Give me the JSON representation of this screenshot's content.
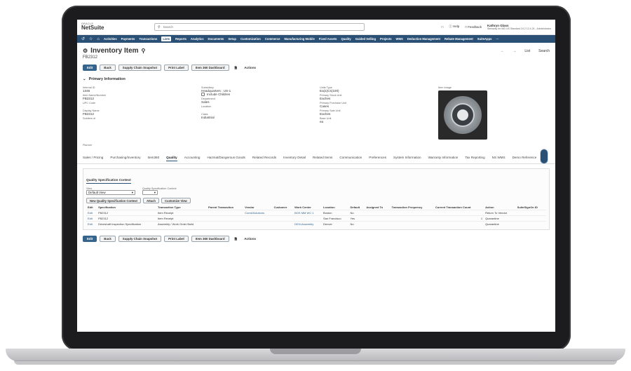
{
  "header": {
    "logo_top": "ORACLE",
    "logo_main": "NetSuite",
    "search_placeholder": "Search",
    "help": "Help",
    "feedback": "Feedback",
    "user_name": "Kathryn Glass",
    "user_role": "Steinway for WD US Standard 24.2 12.4.24 - Administrator"
  },
  "nav": {
    "items": [
      "Activities",
      "Payments",
      "Transactions",
      "Lists",
      "Reports",
      "Analytics",
      "Documents",
      "Setup",
      "Customization",
      "Commerce",
      "Manufacturing Mobile",
      "Fixed Assets",
      "Quality",
      "Guided Selling",
      "Projects",
      "WMS",
      "Deduction Management",
      "Rebate Management",
      "SuiteApps"
    ],
    "active": "Lists",
    "more": "···"
  },
  "page": {
    "title": "Inventory Item",
    "subtitle": "FB2312",
    "nav_prev": "←",
    "nav_next": "→",
    "list_link": "List",
    "search_link": "Search"
  },
  "buttons": {
    "edit": "Edit",
    "back": "Back",
    "supply_chain": "Supply Chain Snapshot",
    "print_label": "Print Label",
    "item360": "Item 360 Dashboard",
    "actions": "Actions"
  },
  "primary": {
    "heading": "Primary Information",
    "col1": [
      {
        "label": "Internal ID",
        "value": "1346"
      },
      {
        "label": "Item Name/Number",
        "value": "FB2312"
      },
      {
        "label": "UPC Code",
        "value": ""
      },
      {
        "label": "Display Name",
        "value": "FB2312"
      },
      {
        "label": "Subitem of",
        "value": ""
      }
    ],
    "col2": {
      "subsidiary_label": "Subsidiary",
      "subsidiary_value": "Headquarters : US-1",
      "include_children": "Include Children",
      "department_label": "Department",
      "department_value": "Sales",
      "location_label": "Location",
      "location_value": "",
      "class_label": "Class",
      "class_value": "Industrial"
    },
    "col3": [
      {
        "label": "Units Type",
        "value": "Ea(1)Cs(100)"
      },
      {
        "label": "Primary Stock Unit",
        "value": "Eaches"
      },
      {
        "label": "Primary Purchase Unit",
        "value": "Cases"
      },
      {
        "label": "Primary Sale Unit",
        "value": "Eaches"
      },
      {
        "label": "Base Unit",
        "value": "ea"
      }
    ],
    "image_label": "Item Image",
    "planner_label": "Planner"
  },
  "subtabs": {
    "items": [
      "Sales / Pricing",
      "Purchasing/Inventory",
      "Item360",
      "Quality",
      "Accounting",
      "Hazmat/Dangerous Goods",
      "Related Records",
      "Inventory Detail",
      "Related Items",
      "Communication",
      "Preferences",
      "System Information",
      "Warranty Information",
      "Tax Reporting",
      "NS WMS",
      "Demo Reference"
    ],
    "active": "Quality"
  },
  "quality": {
    "panel_tab": "Quality Specification Context",
    "view_label": "View",
    "view_value": "Default View",
    "qsc_label": "Quality Specification Context",
    "qsc_value": "",
    "btn_new": "New Quality Specification Context",
    "btn_attach": "Attach",
    "btn_customize": "Customize View",
    "columns": [
      "Edit",
      "Specification",
      "Transaction Type",
      "Parent Transaction",
      "Vendor",
      "Customer",
      "Work Center",
      "Location",
      "Default",
      "Assigned To",
      "Transaction Frequency",
      "Current Transaction Count",
      "Action",
      "SuiteSignOn ID"
    ],
    "rows": [
      [
        "Edit",
        "FB2312",
        "Item Receipt",
        "",
        "CoreASolutions",
        "",
        "BOS MM WC 1",
        "Boston",
        "No",
        "",
        "",
        "",
        "Return To Vendor",
        ""
      ],
      [
        "Edit",
        "FB2312",
        "Item Receipt",
        "",
        "",
        "",
        "",
        "San Francisco",
        "Yes",
        "",
        "",
        "1",
        "Quarantine",
        ""
      ],
      [
        "Edit",
        "Driveshaft Inspection Specification",
        "Assembly / Work Order Build",
        "",
        "",
        "",
        "DEN-Assembly",
        "Denver",
        "No",
        "",
        "",
        "",
        "Quarantine",
        ""
      ]
    ]
  }
}
